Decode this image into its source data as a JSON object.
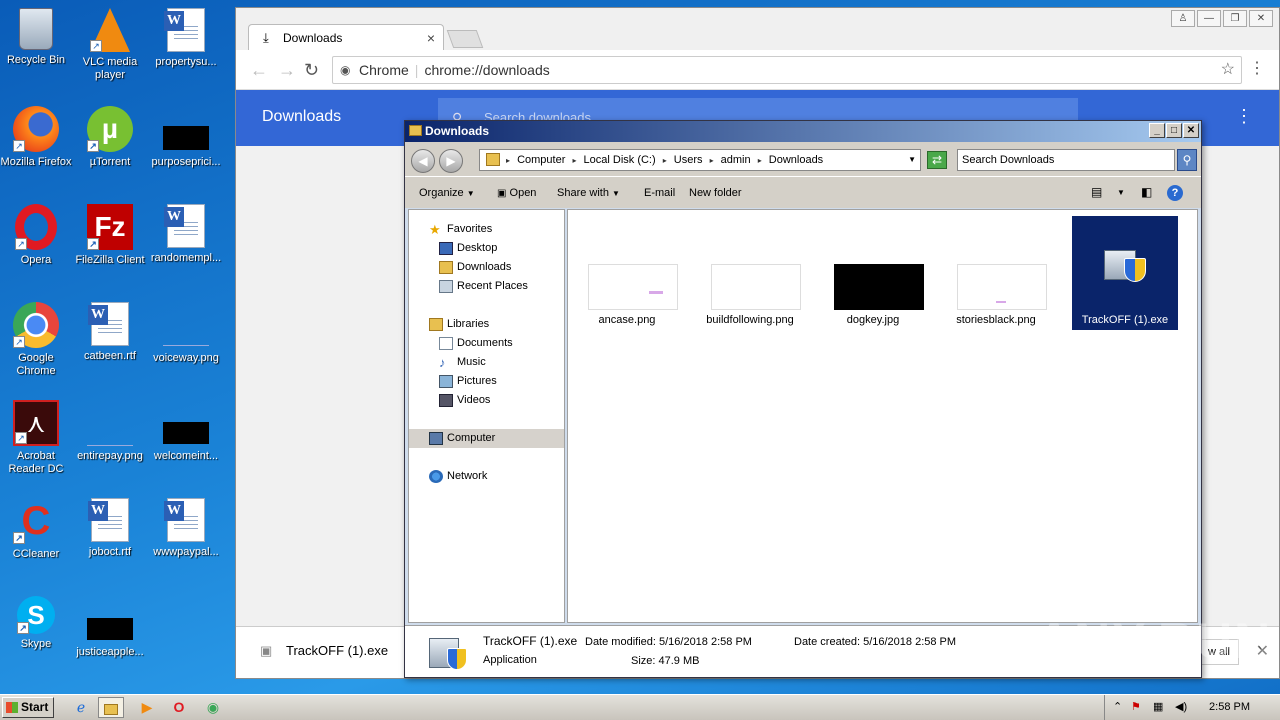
{
  "desktop": {
    "icons": [
      {
        "label": "Recycle Bin"
      },
      {
        "label": "VLC media player"
      },
      {
        "label": "propertysu..."
      },
      {
        "label": "Mozilla Firefox"
      },
      {
        "label": "µTorrent"
      },
      {
        "label": "purposeprici..."
      },
      {
        "label": "Opera"
      },
      {
        "label": "FileZilla Client"
      },
      {
        "label": "randomempl..."
      },
      {
        "label": "Google Chrome"
      },
      {
        "label": "catbeen.rtf"
      },
      {
        "label": "voiceway.png"
      },
      {
        "label": "Acrobat Reader DC"
      },
      {
        "label": "entirepay.png"
      },
      {
        "label": "welcomeint..."
      },
      {
        "label": "CCleaner"
      },
      {
        "label": "joboct.rtf"
      },
      {
        "label": "wwwpaypal..."
      },
      {
        "label": "Skype"
      },
      {
        "label": "justiceapple..."
      }
    ]
  },
  "chrome": {
    "tab_title": "Downloads",
    "omnibox_secure": "Chrome",
    "omnibox_url": "chrome://downloads",
    "page_title": "Downloads",
    "search_placeholder": "Search downloads",
    "shelf_item": "TrackOFF (1).exe",
    "shelf_show_all": "w all"
  },
  "explorer": {
    "title": "Downloads",
    "breadcrumb": [
      "Computer",
      "Local Disk (C:)",
      "Users",
      "admin",
      "Downloads"
    ],
    "search_placeholder": "Search Downloads",
    "commands": [
      "Organize",
      "Open",
      "Share with",
      "E-mail",
      "New folder"
    ],
    "nav": {
      "favorites": "Favorites",
      "desktop": "Desktop",
      "downloads": "Downloads",
      "recent": "Recent Places",
      "libraries": "Libraries",
      "documents": "Documents",
      "music": "Music",
      "pictures": "Pictures",
      "videos": "Videos",
      "computer": "Computer",
      "network": "Network"
    },
    "files": [
      {
        "name": "ancase.png"
      },
      {
        "name": "buildfollowing.png"
      },
      {
        "name": "dogkey.jpg"
      },
      {
        "name": "storiesblack.png"
      },
      {
        "name": "TrackOFF (1).exe"
      }
    ],
    "details": {
      "name": "TrackOFF (1).exe",
      "type": "Application",
      "modified": "Date modified: 5/16/2018 2:58 PM",
      "created": "Date created: 5/16/2018 2:58 PM",
      "size": "Size: 47.9 MB"
    }
  },
  "taskbar": {
    "start": "Start",
    "clock": "2:58 PM"
  },
  "watermark": "ANY.RUN"
}
